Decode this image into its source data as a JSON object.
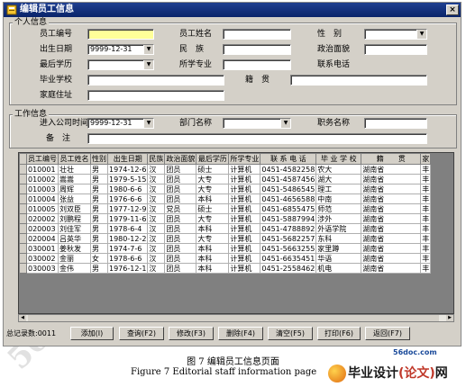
{
  "window": {
    "title": "编辑员工信息",
    "close_glyph": "×"
  },
  "personal": {
    "group_label": "个人信息",
    "fields": {
      "emp_id_label": "员工编号",
      "emp_id_value": "",
      "name_label": "员工姓名",
      "name_value": "",
      "gender_label": "性　别",
      "gender_value": "",
      "birth_label": "出生日期",
      "birth_value": "9999-12-31",
      "ethnicity_label": "民　族",
      "ethnicity_value": "",
      "politics_label": "政治面貌",
      "politics_value": "",
      "education_label": "最后学历",
      "education_value": "",
      "major_label": "所学专业",
      "major_value": "",
      "phone_label": "联系电话",
      "phone_value": "",
      "school_label": "毕业学校",
      "school_value": "",
      "origin_label": "籍　贯",
      "origin_value": "",
      "address_label": "家庭住址",
      "address_value": ""
    }
  },
  "work": {
    "group_label": "工作信息",
    "fields": {
      "join_date_label": "进入公司时间",
      "join_date_value": "9999-12-31",
      "dept_label": "部门名称",
      "dept_value": "",
      "title_label": "职务名称",
      "title_value": "",
      "remark_label": "备　注",
      "remark_value": ""
    }
  },
  "table": {
    "columns": [
      "员工编号",
      "员工姓名",
      "性别",
      "出生日期",
      "民族",
      "政治面貌",
      "最后学历",
      "所学专业",
      "联 系 电 话",
      "毕 业 学 校",
      "籍　　贯",
      "家"
    ],
    "rows": [
      [
        "010001",
        "壮壮",
        "男",
        "1974-12-6",
        "汉",
        "团员",
        "硕士",
        "计算机",
        "0451-4582258",
        "农大",
        "湖南省",
        "丰"
      ],
      [
        "010002",
        "嵩嵩",
        "男",
        "1979-5-15",
        "汉",
        "团员",
        "大专",
        "计算机",
        "0451-4587456",
        "湖大",
        "湖南省",
        "丰"
      ],
      [
        "010003",
        "周辉",
        "男",
        "1980-6-6",
        "汉",
        "团员",
        "大专",
        "计算机",
        "0451-5486545",
        "理工",
        "湖南省",
        "丰"
      ],
      [
        "010004",
        "张益",
        "男",
        "1976-6-6",
        "汉",
        "团员",
        "本科",
        "计算机",
        "0451-4656588",
        "中南",
        "湖南省",
        "丰"
      ],
      [
        "010005",
        "刘双臣",
        "男",
        "1977-12-9",
        "汉",
        "党员",
        "硕士",
        "计算机",
        "0451-6855475",
        "师范",
        "湖南省",
        "丰"
      ],
      [
        "020002",
        "刘鹏程",
        "男",
        "1979-11-6",
        "汉",
        "团员",
        "大专",
        "计算机",
        "0451-5887994",
        "涉外",
        "湖南省",
        "丰"
      ],
      [
        "020003",
        "刘佳军",
        "男",
        "1978-6-4",
        "汉",
        "团员",
        "本科",
        "计算机",
        "0451-4788892",
        "外语学院",
        "湖南省",
        "丰"
      ],
      [
        "020004",
        "吕英华",
        "男",
        "1980-12-2",
        "汉",
        "团员",
        "大专",
        "计算机",
        "0451-5682257",
        "东科",
        "湖南省",
        "丰"
      ],
      [
        "030001",
        "姜秋发",
        "男",
        "1974-7-6",
        "汉",
        "团员",
        "本科",
        "计算机",
        "0451-5663255",
        "家里蹲",
        "湖南省",
        "丰"
      ],
      [
        "030002",
        "金丽",
        "女",
        "1978-6-6",
        "汉",
        "团员",
        "本科",
        "计算机",
        "0451-6635451",
        "华语",
        "湖南省",
        "丰"
      ],
      [
        "030003",
        "金伟",
        "男",
        "1976-12-1",
        "汉",
        "团员",
        "本科",
        "计算机",
        "0451-2558462",
        "机电",
        "湖南省",
        "丰"
      ]
    ]
  },
  "status": {
    "record_count": "总记录数:0011"
  },
  "buttons": {
    "add": "添加(I)",
    "query": "查询(F2)",
    "modify": "修改(F3)",
    "delete": "删除(F4)",
    "clear": "清空(F5)",
    "print": "打印(F6)",
    "back": "返回(F7)"
  },
  "caption": {
    "cn": "图 7  编辑员工信息页面",
    "en": "Figure 7 Editorial staff information page"
  },
  "branding": {
    "url": "56doc.com",
    "logo_main": "毕业设计",
    "logo_paren": "(论文)",
    "logo_suffix": "网",
    "watermark": "56DOC.COM"
  },
  "colors": {
    "title_bar": "#0a246a",
    "window_bg": "#d4d0c8",
    "highlight_field": "#ffff99",
    "grid_bg": "#808080"
  }
}
